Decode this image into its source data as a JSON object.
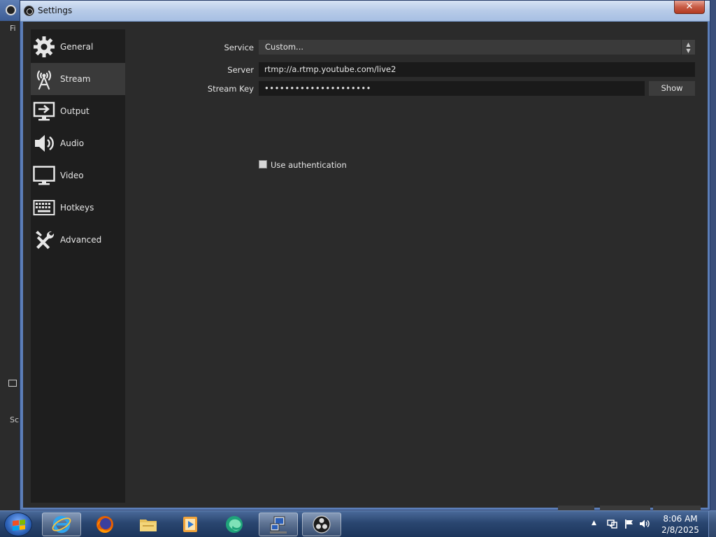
{
  "background_app": {
    "text_f": "Fi",
    "text_sc": "Sc"
  },
  "window": {
    "title": "Settings",
    "close_label": "✕"
  },
  "sidebar": {
    "items": [
      {
        "label": "General",
        "icon": "gear-icon"
      },
      {
        "label": "Stream",
        "icon": "antenna-icon",
        "active": true
      },
      {
        "label": "Output",
        "icon": "output-monitor-icon"
      },
      {
        "label": "Audio",
        "icon": "speaker-icon"
      },
      {
        "label": "Video",
        "icon": "monitor-icon"
      },
      {
        "label": "Hotkeys",
        "icon": "keyboard-icon"
      },
      {
        "label": "Advanced",
        "icon": "tools-icon"
      }
    ]
  },
  "stream": {
    "service_label": "Service",
    "service_value": "Custom...",
    "server_label": "Server",
    "server_value": "rtmp://a.rtmp.youtube.com/live2",
    "stream_key_label": "Stream Key",
    "stream_key_value": "•••••••••••••••••••••",
    "show_label": "Show",
    "use_auth_label": "Use authentication",
    "use_auth_checked": false
  },
  "taskbar": {
    "apps": [
      "internet-explorer-icon",
      "firefox-icon",
      "file-explorer-icon",
      "media-player-icon",
      "edge-icon",
      "network-setup-icon",
      "obs-icon"
    ],
    "clock_time": "8:06 AM",
    "clock_date": "2/8/2025"
  }
}
